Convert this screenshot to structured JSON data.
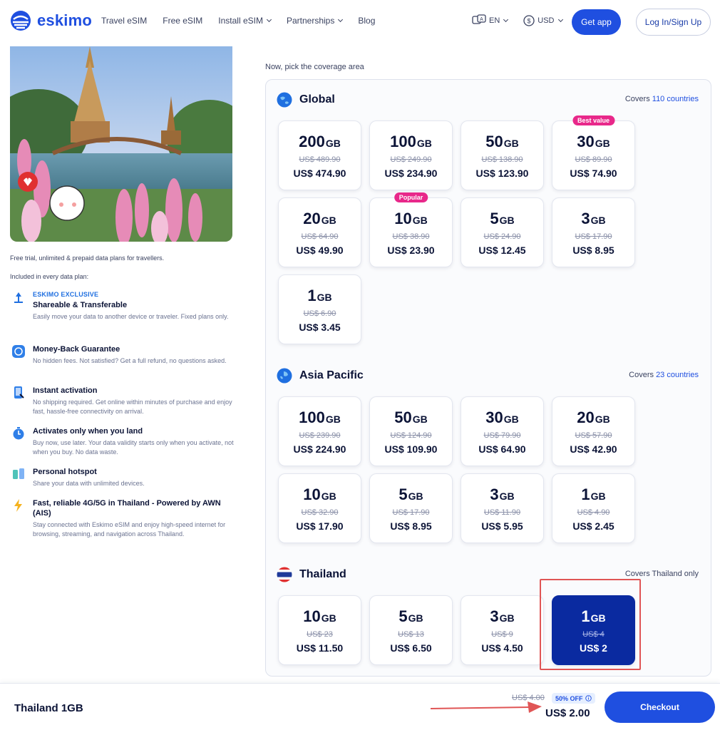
{
  "brand": {
    "name": "eskimo",
    "accent": "#1f4fe0",
    "selected": "#0a2aa0",
    "badge": "#e8288a"
  },
  "nav": [
    {
      "label": "Travel eSIM",
      "dropdown": false
    },
    {
      "label": "Free eSIM",
      "dropdown": false
    },
    {
      "label": "Install eSIM",
      "dropdown": true
    },
    {
      "label": "Partnerships",
      "dropdown": true
    },
    {
      "label": "Blog",
      "dropdown": false
    }
  ],
  "header": {
    "language": "EN",
    "currency": "USD",
    "get_app": "Get app",
    "login": "Log In/Sign Up"
  },
  "left": {
    "tagline": "Free trial, unlimited & prepaid data plans for travellers.",
    "included_label": "Included in every data plan:",
    "features": [
      {
        "icon": "transfer-icon",
        "tag": "ESKIMO EXCLUSIVE",
        "title": "Shareable & Transferable",
        "desc": "Easily move your data to another device or traveler. Fixed plans only."
      },
      {
        "icon": "money-back-icon",
        "tag": "",
        "title": "Money-Back Guarantee",
        "desc": "No hidden fees. Not satisfied? Get a full refund, no questions asked."
      },
      {
        "icon": "instant-activation-icon",
        "tag": "",
        "title": "Instant activation",
        "desc": "No shipping required. Get online within minutes of purchase and enjoy fast, hassle-free connectivity on arrival."
      },
      {
        "icon": "clock-icon",
        "tag": "",
        "title": "Activates only when you land",
        "desc": "Buy now, use later. Your data validity starts only when you activate, not when you buy. No data waste."
      },
      {
        "icon": "hotspot-icon",
        "tag": "",
        "title": "Personal hotspot",
        "desc": "Share your data with unlimited devices."
      },
      {
        "icon": "lightning-icon",
        "tag": "",
        "title": "Fast, reliable 4G/5G in Thailand - Powered by AWN (AIS)",
        "desc": "Stay connected with Eskimo eSIM and enjoy high-speed internet for browsing, streaming, and navigation across Thailand."
      }
    ]
  },
  "coverage": {
    "pick_label": "Now, pick the coverage area",
    "sections": [
      {
        "name": "Global",
        "covers_prefix": "Covers ",
        "covers_highlight": "110 countries",
        "covers_suffix": "",
        "plans": [
          {
            "gb": "200",
            "unit": "GB",
            "old": "US$ 489.90",
            "price": "US$ 474.90",
            "badge": ""
          },
          {
            "gb": "100",
            "unit": "GB",
            "old": "US$ 249.90",
            "price": "US$ 234.90",
            "badge": ""
          },
          {
            "gb": "50",
            "unit": "GB",
            "old": "US$ 138.90",
            "price": "US$ 123.90",
            "badge": ""
          },
          {
            "gb": "30",
            "unit": "GB",
            "old": "US$ 89.90",
            "price": "US$ 74.90",
            "badge": "Best value"
          },
          {
            "gb": "20",
            "unit": "GB",
            "old": "US$ 64.90",
            "price": "US$ 49.90",
            "badge": ""
          },
          {
            "gb": "10",
            "unit": "GB",
            "old": "US$ 38.90",
            "price": "US$ 23.90",
            "badge": "Popular"
          },
          {
            "gb": "5",
            "unit": "GB",
            "old": "US$ 24.90",
            "price": "US$ 12.45",
            "badge": ""
          },
          {
            "gb": "3",
            "unit": "GB",
            "old": "US$ 17.90",
            "price": "US$ 8.95",
            "badge": ""
          },
          {
            "gb": "1",
            "unit": "GB",
            "old": "US$ 6.90",
            "price": "US$ 3.45",
            "badge": ""
          }
        ]
      },
      {
        "name": "Asia Pacific",
        "covers_prefix": "Covers ",
        "covers_highlight": "23 countries",
        "covers_suffix": "",
        "plans": [
          {
            "gb": "100",
            "unit": "GB",
            "old": "US$ 239.90",
            "price": "US$ 224.90",
            "badge": ""
          },
          {
            "gb": "50",
            "unit": "GB",
            "old": "US$ 124.90",
            "price": "US$ 109.90",
            "badge": ""
          },
          {
            "gb": "30",
            "unit": "GB",
            "old": "US$ 79.90",
            "price": "US$ 64.90",
            "badge": ""
          },
          {
            "gb": "20",
            "unit": "GB",
            "old": "US$ 57.90",
            "price": "US$ 42.90",
            "badge": ""
          },
          {
            "gb": "10",
            "unit": "GB",
            "old": "US$ 32.90",
            "price": "US$ 17.90",
            "badge": ""
          },
          {
            "gb": "5",
            "unit": "GB",
            "old": "US$ 17.90",
            "price": "US$ 8.95",
            "badge": ""
          },
          {
            "gb": "3",
            "unit": "GB",
            "old": "US$ 11.90",
            "price": "US$ 5.95",
            "badge": ""
          },
          {
            "gb": "1",
            "unit": "GB",
            "old": "US$ 4.90",
            "price": "US$ 2.45",
            "badge": ""
          }
        ]
      },
      {
        "name": "Thailand",
        "covers_prefix": "Covers Thailand only",
        "covers_highlight": "",
        "covers_suffix": "",
        "plans": [
          {
            "gb": "10",
            "unit": "GB",
            "old": "US$ 23",
            "price": "US$ 11.50",
            "badge": ""
          },
          {
            "gb": "5",
            "unit": "GB",
            "old": "US$ 13",
            "price": "US$ 6.50",
            "badge": ""
          },
          {
            "gb": "3",
            "unit": "GB",
            "old": "US$ 9",
            "price": "US$ 4.50",
            "badge": ""
          },
          {
            "gb": "1",
            "unit": "GB",
            "old": "US$ 4",
            "price": "US$ 2",
            "badge": "",
            "selected": true
          }
        ]
      }
    ]
  },
  "checkout": {
    "plan_name": "Thailand 1GB",
    "old_price": "US$ 4.00",
    "discount": "50% OFF",
    "price": "US$ 2.00",
    "button": "Checkout"
  }
}
